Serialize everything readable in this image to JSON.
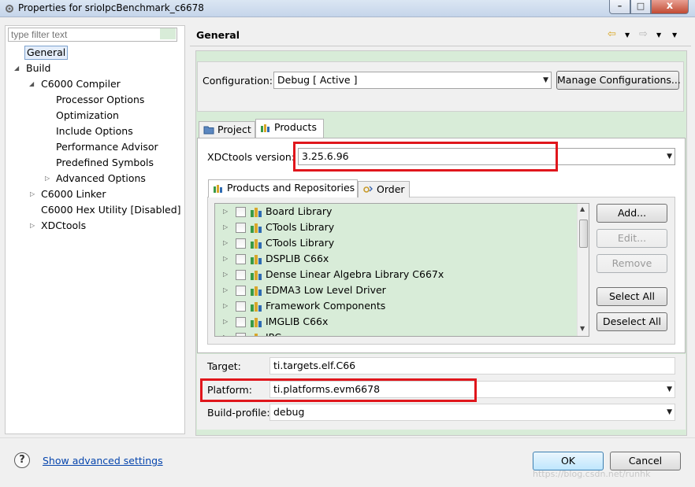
{
  "window": {
    "title": "Properties for srioIpcBenchmark_c6678",
    "min_label": "–",
    "max_label": "□",
    "close_label": "x"
  },
  "filter": {
    "placeholder": "type filter text"
  },
  "tree": [
    {
      "label": "General",
      "selected": true
    },
    {
      "label": "Build",
      "expanded": true
    },
    {
      "label": "C6000 Compiler",
      "expanded": true
    },
    {
      "label": "Processor Options"
    },
    {
      "label": "Optimization"
    },
    {
      "label": "Include Options"
    },
    {
      "label": "Performance Advisor"
    },
    {
      "label": "Predefined Symbols"
    },
    {
      "label": "Advanced Options",
      "collapsed": true
    },
    {
      "label": "C6000 Linker",
      "collapsed": true
    },
    {
      "label": "C6000 Hex Utility  [Disabled]"
    },
    {
      "label": "XDCtools",
      "collapsed": true
    }
  ],
  "page": {
    "title": "General"
  },
  "configuration": {
    "label": "Configuration:",
    "value": "Debug  [ Active ]",
    "manage_button": "Manage Configurations..."
  },
  "tabs": {
    "project": "Project",
    "products": "Products"
  },
  "xdc": {
    "label": "XDCtools version:",
    "value": "3.25.6.96"
  },
  "subtabs": {
    "repos": "Products and Repositories",
    "order": "Order"
  },
  "products": [
    "Board Library",
    "CTools Library",
    "CTools Library",
    "DSPLIB C66x",
    "Dense Linear Algebra Library C667x",
    "EDMA3 Low Level Driver",
    "Framework Components",
    "IMGLIB C66x",
    "IPC"
  ],
  "repo_buttons": {
    "add": "Add...",
    "edit": "Edit...",
    "remove": "Remove",
    "select_all": "Select All",
    "deselect_all": "Deselect All"
  },
  "fields": {
    "target_label": "Target:",
    "target_value": "ti.targets.elf.C66",
    "platform_label": "Platform:",
    "platform_value": "ti.platforms.evm6678",
    "build_profile_label": "Build-profile:",
    "build_profile_value": "debug"
  },
  "footer": {
    "help": "?",
    "advanced_link": "Show advanced settings",
    "ok": "OK",
    "cancel": "Cancel",
    "watermark": "https://blog.csdn.net/runhk"
  },
  "colors": {
    "accent_green": "#d8ecd8",
    "highlight_red": "#e0161c",
    "link_blue": "#0645ad"
  }
}
